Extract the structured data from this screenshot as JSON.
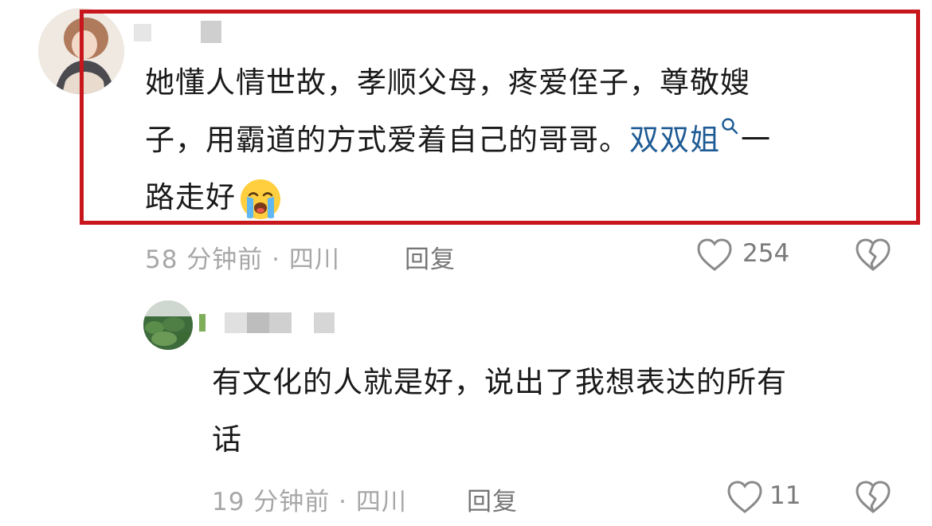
{
  "comment": {
    "text_line1": "她懂人情世故，孝顺父母，疼爱侄子，尊敬嫂",
    "text_line2_plain": "子，用霸道的方式爱着自己的哥哥。",
    "text_line2_link": "双双姐",
    "text_line2_after": "一",
    "text_line3": "路走好",
    "emoji": "loudly-crying-face-emoji",
    "time_location": "58 分钟前 · 四川",
    "reply_label": "回复",
    "like_count": "254"
  },
  "reply": {
    "text_line1": "有文化的人就是好，说出了我想表达的所有",
    "text_line2": "话",
    "time_location": "19 分钟前 · 四川",
    "reply_label": "回复",
    "like_count": "11"
  },
  "colors": {
    "highlight_border": "#c8171c",
    "link": "#1e5b94",
    "meta": "#a7a7a7"
  }
}
